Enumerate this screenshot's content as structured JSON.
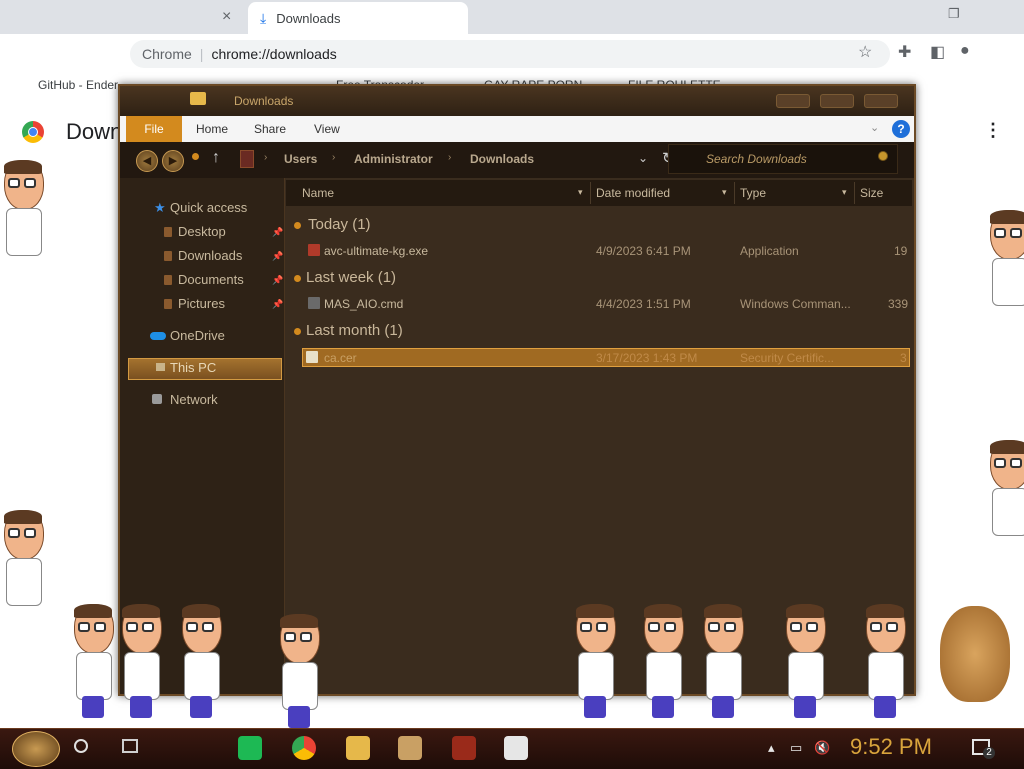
{
  "browser": {
    "tab_title": "Downloads",
    "tab_close": "×",
    "app_name": "Chrome",
    "url": "chrome://downloads",
    "page_title": "Downloads",
    "bookmarks": [
      "GitHub - Ender",
      "Free Transcoder",
      "GAY RAPE PORN",
      "FILE ROULETTE"
    ],
    "kebab": "⋮"
  },
  "explorer": {
    "title": "Downloads",
    "ribbon": {
      "file": "File",
      "tabs": [
        "Home",
        "Share",
        "View"
      ],
      "help": "?"
    },
    "breadcrumb": [
      "Users",
      "Administrator",
      "Downloads"
    ],
    "search_placeholder": "Search Downloads",
    "nav": {
      "quick_access": "Quick access",
      "items": [
        "Desktop",
        "Downloads",
        "Documents",
        "Pictures"
      ],
      "onedrive": "OneDrive",
      "this_pc": "This PC",
      "network": "Network"
    },
    "columns": [
      "Name",
      "Date modified",
      "Type",
      "Size"
    ],
    "groups": [
      {
        "header": "Today (1)",
        "files": [
          {
            "name": "avc-ultimate-kg.exe",
            "date": "4/9/2023 6:41 PM",
            "type": "Application",
            "size": "19"
          }
        ]
      },
      {
        "header": "Last week (1)",
        "files": [
          {
            "name": "MAS_AIO.cmd",
            "date": "4/4/2023 1:51 PM",
            "type": "Windows Comman...",
            "size": "339"
          }
        ]
      },
      {
        "header": "Last month (1)",
        "files": [
          {
            "name": "ca.cer",
            "date": "3/17/2023 1:43 PM",
            "type": "Security Certific...",
            "size": "3"
          }
        ]
      }
    ]
  },
  "taskbar": {
    "clock": "9:52 PM",
    "notification_count": "2"
  },
  "colors": {
    "accent_orange": "#d38a1e",
    "explorer_bg": "#3a2c1e",
    "clock_gold": "#d9a43c"
  }
}
